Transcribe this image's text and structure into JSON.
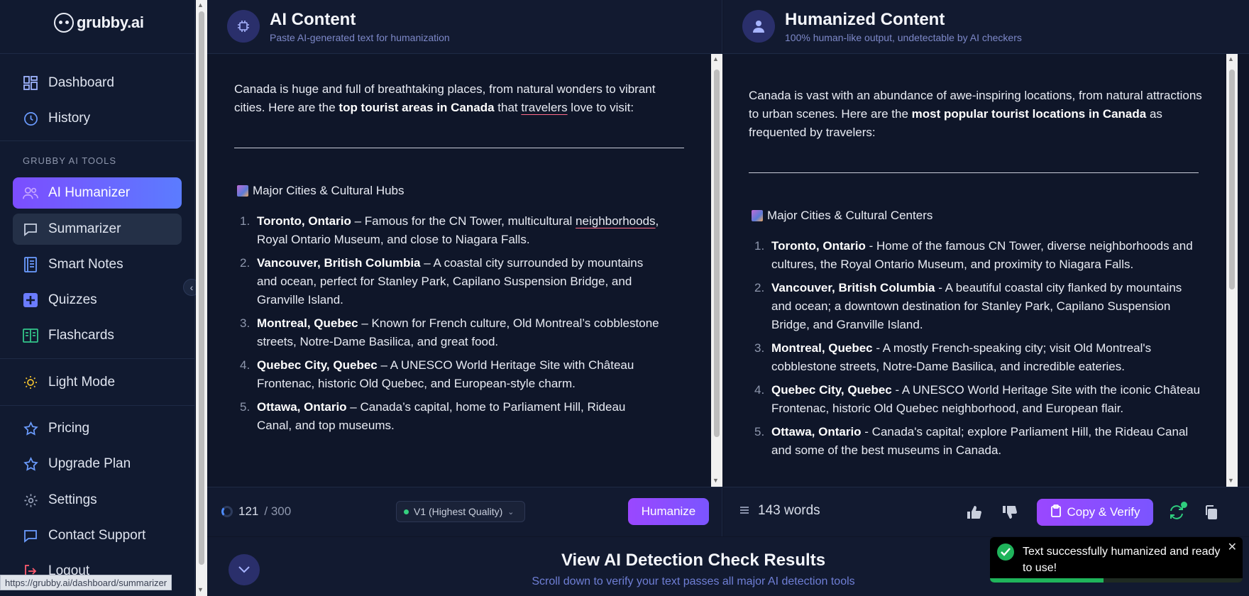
{
  "app": {
    "logo_text": "grubby.ai"
  },
  "sidebar": {
    "nav_top": [
      {
        "label": "Dashboard"
      },
      {
        "label": "History"
      }
    ],
    "section_label": "GRUBBY AI TOOLS",
    "tools": [
      {
        "label": "AI Humanizer"
      },
      {
        "label": "Summarizer"
      },
      {
        "label": "Smart Notes"
      },
      {
        "label": "Quizzes"
      },
      {
        "label": "Flashcards"
      }
    ],
    "light_mode": "Light Mode",
    "nav_bottom": [
      {
        "label": "Pricing"
      },
      {
        "label": "Upgrade Plan"
      },
      {
        "label": "Settings"
      },
      {
        "label": "Contact Support"
      },
      {
        "label": "Logout"
      }
    ]
  },
  "status_url": "https://grubby.ai/dashboard/summarizer",
  "ai_panel": {
    "title": "AI Content",
    "subtitle": "Paste AI-generated text for humanization",
    "intro_a": "Canada is huge and full of breathtaking places, from natural wonders to vibrant cities. Here are the ",
    "intro_bold": "top tourist areas in Canada",
    "intro_b": " that ",
    "intro_underlined": "travelers",
    "intro_c": " love to visit:",
    "section_heading": "Major Cities & Cultural Hubs",
    "items": [
      {
        "num": "1.",
        "bold": "Toronto, Ontario",
        "text": " – Famous for the CN Tower, multicultural ",
        "underlined": "neighborhoods",
        "tail": ", Royal Ontario Museum, and close to Niagara Falls."
      },
      {
        "num": "2.",
        "bold": "Vancouver, British Columbia",
        "text": " – A coastal city surrounded by mountains and ocean, perfect for Stanley Park, Capilano Suspension Bridge, and Granville Island.",
        "underlined": "",
        "tail": ""
      },
      {
        "num": "3.",
        "bold": "Montreal, Quebec",
        "text": " – Known for French culture, Old Montreal’s cobblestone streets, Notre-Dame Basilica, and great food.",
        "underlined": "",
        "tail": ""
      },
      {
        "num": "4.",
        "bold": "Quebec City, Quebec",
        "text": " – A UNESCO World Heritage Site with Château Frontenac, historic Old Quebec, and European-style charm.",
        "underlined": "",
        "tail": ""
      },
      {
        "num": "5.",
        "bold": "Ottawa, Ontario",
        "text": " – Canada’s capital, home to Parliament Hill, Rideau Canal, and top museums.",
        "underlined": "",
        "tail": ""
      }
    ],
    "word_count": "121",
    "word_limit": "/ 300",
    "model": "V1 (Highest Quality)",
    "humanize_label": "Humanize"
  },
  "human_panel": {
    "title": "Humanized Content",
    "subtitle": "100% human-like output, undetectable by AI checkers",
    "intro_a": "Canada is vast with an abundance of awe-inspiring locations, from natural attractions to urban scenes. Here are the ",
    "intro_bold": "most popular tourist locations in Canada",
    "intro_c": " as frequented by travelers:",
    "section_heading": "Major Cities & Cultural Centers",
    "items": [
      {
        "num": "1.",
        "bold": "Toronto, Ontario",
        "text": " - Home of the famous CN Tower, diverse neighborhoods and cultures, the Royal Ontario Museum, and proximity to Niagara Falls."
      },
      {
        "num": "2.",
        "bold": "Vancouver, British Columbia",
        "text": " - A beautiful coastal city flanked by mountains and ocean; a downtown destination for Stanley Park, Capilano Suspension Bridge, and Granville Island."
      },
      {
        "num": "3.",
        "bold": "Montreal, Quebec",
        "text": " - A mostly French-speaking city; visit Old Montreal's cobblestone streets, Notre-Dame Basilica, and incredible eateries."
      },
      {
        "num": "4.",
        "bold": "Quebec City, Quebec",
        "text": " - A UNESCO World Heritage Site with the iconic Château Frontenac, historic Old Quebec neighborhood, and European flair."
      },
      {
        "num": "5.",
        "bold": "Ottawa, Ontario",
        "text": " - Canada's capital; explore Parliament Hill, the Rideau Canal and some of the best museums in Canada."
      }
    ],
    "words": "143 words",
    "copy_label": "Copy & Verify"
  },
  "detection": {
    "title": "View AI Detection Check Results",
    "subtitle": "Scroll down to verify your text passes all major AI detection tools"
  },
  "toast": {
    "message": "Text successfully humanized and ready to use!",
    "close": "✕",
    "progress": 0.45
  },
  "colors": {
    "accent": "#7c4dff",
    "success": "#1fb45b",
    "background": "#0f1527"
  }
}
